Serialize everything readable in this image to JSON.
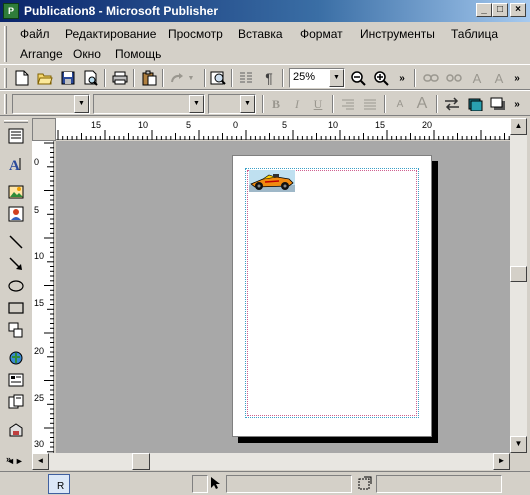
{
  "window": {
    "title": "Publication8 - Microsoft Publisher",
    "app_icon_letter": "P"
  },
  "menu": {
    "items": [
      "Файл",
      "Редактирование",
      "Просмотр",
      "Вставка",
      "Формат",
      "Инструменты",
      "Таблица",
      "Arrange",
      "Окно",
      "Помощь"
    ]
  },
  "toolbar": {
    "zoom_value": "25%"
  },
  "rulers": {
    "horizontal_labels": [
      "15",
      "10",
      "5",
      "0",
      "5",
      "10",
      "15",
      "20"
    ],
    "vertical_labels": [
      "0",
      "5",
      "10",
      "15",
      "20",
      "25",
      "30"
    ]
  },
  "status": {
    "page_indicator": "R"
  },
  "colors": {
    "title_start": "#0a246a",
    "title_end": "#a6caf0",
    "canvas_bg": "#a8a8a8",
    "margin_guide": "#3aa0c8"
  }
}
